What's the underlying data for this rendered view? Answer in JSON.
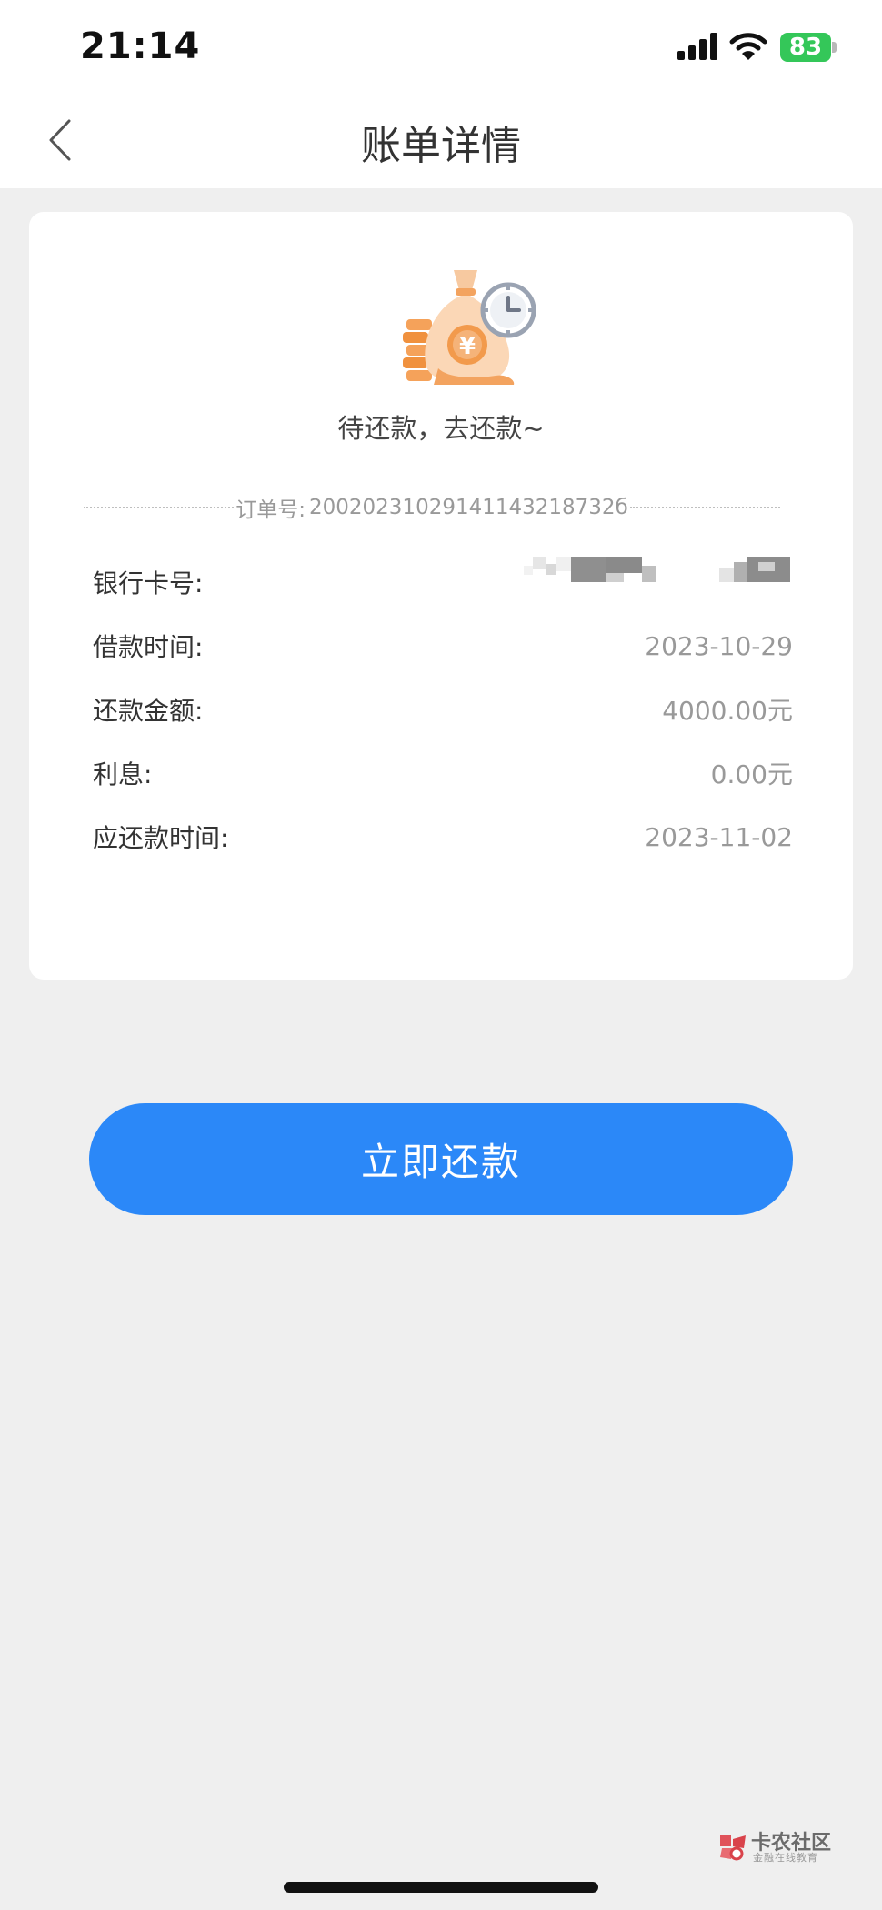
{
  "status_bar": {
    "time": "21:14",
    "battery": "83",
    "icons": [
      "signal-icon",
      "wifi-icon",
      "battery-icon"
    ]
  },
  "nav": {
    "title": "账单详情",
    "back_icon": "chevron-left-icon"
  },
  "bill": {
    "illustration_icon": "money-bag-clock-icon",
    "status": "待还款，去还款~",
    "order_label": "订单号:",
    "order_number": "20020231029141143218732б",
    "rows": [
      {
        "label": "银行卡号:",
        "value": ""
      },
      {
        "label": "借款时间:",
        "value": "2023-10-29"
      },
      {
        "label": "还款金额:",
        "value": "4000.00元"
      },
      {
        "label": "利息:",
        "value": "0.00元"
      },
      {
        "label": "应还款时间:",
        "value": "2023-11-02"
      }
    ]
  },
  "actions": {
    "repay_label": "立即还款"
  },
  "watermark": {
    "title": "卡农社区",
    "subtitle": "金融在线教育"
  },
  "colors": {
    "primary": "#2b88f8",
    "background": "#efefef",
    "battery": "#34c759"
  }
}
